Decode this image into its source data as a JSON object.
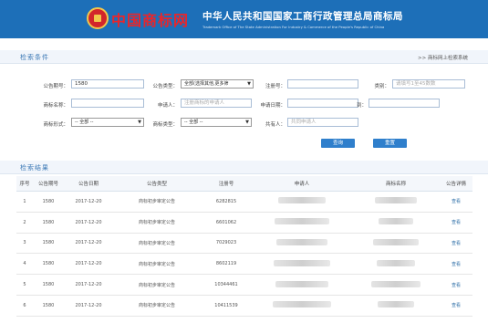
{
  "header": {
    "logo_text": "中国商标网",
    "org_cn": "中华人民共和国国家工商行政管理总局商标局",
    "org_en": "Trademark Office of The State Administration For Industry & Commerce of the People's Republic of China"
  },
  "search": {
    "section_title": "检索条件",
    "link": ">> 商标网上检索系统",
    "fields": {
      "issue_no_label": "公告期号：",
      "issue_no_value": "1580",
      "type_label": "公告类型：",
      "type_value": "全部(选择其他,更多筛",
      "reg_no_label": "注册号：",
      "class_label": "类别：",
      "class_placeholder": "请填写1至45数数",
      "tm_name_label": "商标名称：",
      "applicant_label": "申请人：",
      "applicant_placeholder": "注册商标的申请人",
      "apply_date_label": "申请日期：",
      "date_to_label": "到：",
      "form_label": "商标形式：",
      "form_value": "-- 全部 --",
      "tm_type_label": "商标类型：",
      "tm_type_value": "-- 全部 --",
      "co_owner_label": "共有人：",
      "co_owner_placeholder": "共同申请人"
    },
    "query_button": "查询",
    "reset_button": "重置"
  },
  "results": {
    "section_title": "检索结果",
    "columns": [
      "序号",
      "公告期号",
      "公告日期",
      "公告类型",
      "注册号",
      "申请人",
      "商标名称",
      "公告详情"
    ],
    "rows": [
      {
        "idx": "1",
        "issue": "1580",
        "date": "2017-12-20",
        "type": "商标初步审定公告",
        "reg": "6282815",
        "detail": "查看"
      },
      {
        "idx": "2",
        "issue": "1580",
        "date": "2017-12-20",
        "type": "商标初步审定公告",
        "reg": "6601062",
        "detail": "查看"
      },
      {
        "idx": "3",
        "issue": "1580",
        "date": "2017-12-20",
        "type": "商标初步审定公告",
        "reg": "7029023",
        "detail": "查看"
      },
      {
        "idx": "4",
        "issue": "1580",
        "date": "2017-12-20",
        "type": "商标初步审定公告",
        "reg": "8602119",
        "detail": "查看"
      },
      {
        "idx": "5",
        "issue": "1580",
        "date": "2017-12-20",
        "type": "商标初步审定公告",
        "reg": "10344461",
        "detail": "查看"
      },
      {
        "idx": "6",
        "issue": "1580",
        "date": "2017-12-20",
        "type": "商标初步审定公告",
        "reg": "10411539",
        "detail": "查看"
      }
    ]
  }
}
